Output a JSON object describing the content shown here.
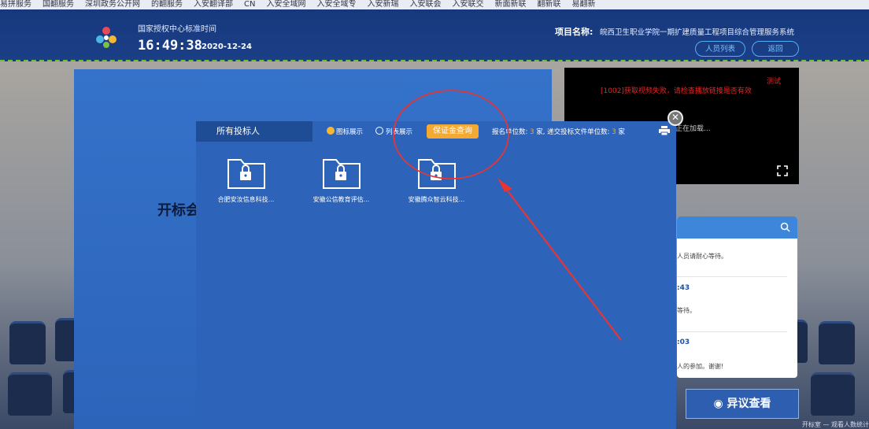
{
  "bookmarks": [
    "易拼服务",
    "国翻服务",
    "深圳政务公开网",
    "的翻服务",
    "入安翻译部",
    "CN",
    "入安全域网",
    "入安全域专",
    "入安新瑞",
    "入安联会",
    "入安联交",
    "新面新联",
    "翻新联",
    "易翻新"
  ],
  "header": {
    "time_label": "国家授权中心标准时间",
    "clock": "16:49:38",
    "date": "2020-12-24",
    "project_label": "项目名称:",
    "project_name": "皖西卫生职业学院一期扩建质量工程项目综合管理服务系统",
    "btn_people": "人员列表",
    "btn_back": "返回"
  },
  "stage": {
    "title": "开标会"
  },
  "video": {
    "test_label": "测试",
    "error_text": "[1002]获取视频失败，请检查播放链接是否有效",
    "loading_text": "正在加载..."
  },
  "chat": {
    "messages": [
      {
        "time": "",
        "text": "人员请耐心等待。"
      },
      {
        "time": ":43",
        "text": "等待。"
      },
      {
        "time": ":03",
        "text": "人的参加。谢谢!"
      }
    ]
  },
  "objection_button": "异议查看",
  "bottom_text": "开标室 — 观看人数统计",
  "modal": {
    "tab_label": "所有投标人",
    "view_icon_label": "图标展示",
    "view_list_label": "列表展示",
    "view_selected": "图标展示",
    "deposit_button": "保证金查询",
    "count_prefix": "报名单位数:",
    "registered_count": "3",
    "count_mid": "家, 递交投标文件单位数:",
    "submitted_count": "3",
    "count_suffix": "家",
    "bidders": [
      {
        "name": "合肥安汝信息科技..."
      },
      {
        "name": "安徽公信教育评估..."
      },
      {
        "name": "安徽腾众智云科技..."
      }
    ]
  },
  "colors": {
    "accent_orange": "#f4a932",
    "header_blue": "#17387c",
    "modal_blue": "#2d64ba",
    "annotation_red": "#e53535"
  }
}
